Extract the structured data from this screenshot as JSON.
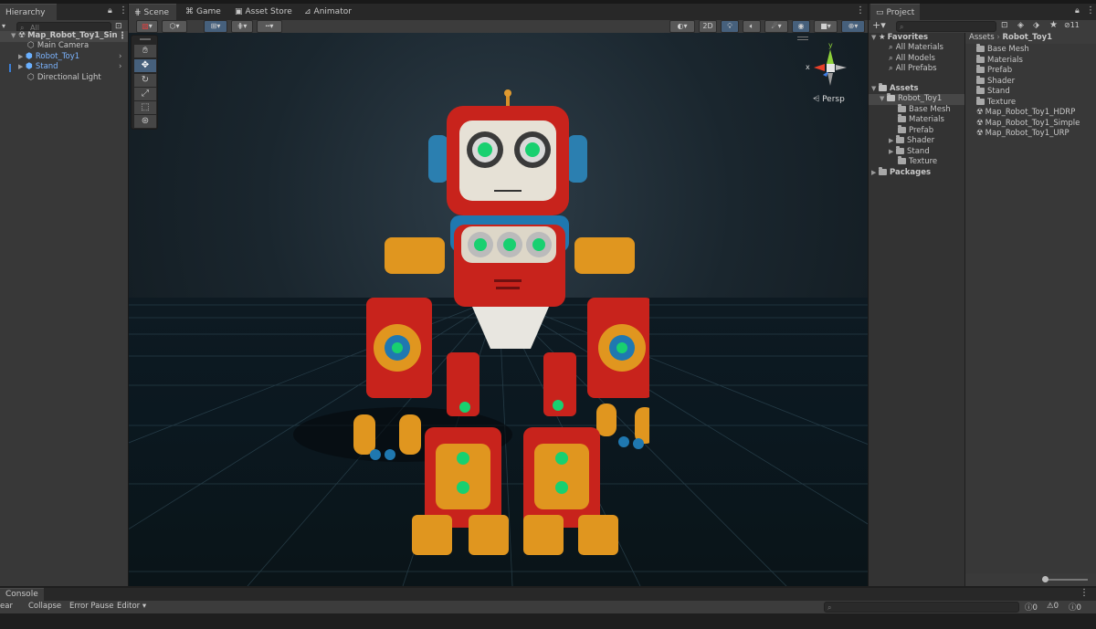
{
  "hierarchy": {
    "tab_label": "Hierarchy",
    "search_placeholder": "All",
    "items": [
      {
        "label": "Map_Robot_Toy1_Sin",
        "indent": 0
      },
      {
        "label": "Main Camera",
        "indent": 1
      },
      {
        "label": "Robot_Toy1",
        "indent": 1
      },
      {
        "label": "Stand",
        "indent": 1
      },
      {
        "label": "Directional Light",
        "indent": 1
      }
    ]
  },
  "center_tabs": [
    "Scene",
    "Game",
    "Asset Store",
    "Animator"
  ],
  "scene_toolbar": {
    "mode_2d": "2D"
  },
  "gizmo": {
    "y_label": "y",
    "x_label": "x",
    "persp_label": "Persp"
  },
  "project": {
    "tab_label": "Project",
    "favorites_label": "Favorites",
    "favorites": [
      "All Materials",
      "All Models",
      "All Prefabs"
    ],
    "assets_label": "Assets",
    "tree": [
      "Robot_Toy1",
      "Base Mesh",
      "Materials",
      "Prefab",
      "Shader",
      "Stand",
      "Texture"
    ],
    "packages_label": "Packages",
    "breadcrumb": [
      "Assets",
      "Robot_Toy1"
    ],
    "files": [
      "Base Mesh",
      "Materials",
      "Prefab",
      "Shader",
      "Stand",
      "Texture",
      "Map_Robot_Toy1_HDRP",
      "Map_Robot_Toy1_Simple",
      "Map_Robot_Toy1_URP"
    ],
    "hidden_count": "11"
  },
  "console": {
    "tab_label": "Console",
    "clear_label": "ear",
    "collapse_label": "Collapse",
    "error_pause_label": "Error Pause",
    "editor_label": "Editor",
    "error_count": "0",
    "warning_count": "0",
    "message_count": "0"
  },
  "colors": {
    "accent_blue": "#7cb4ff",
    "selection": "#46607c"
  }
}
